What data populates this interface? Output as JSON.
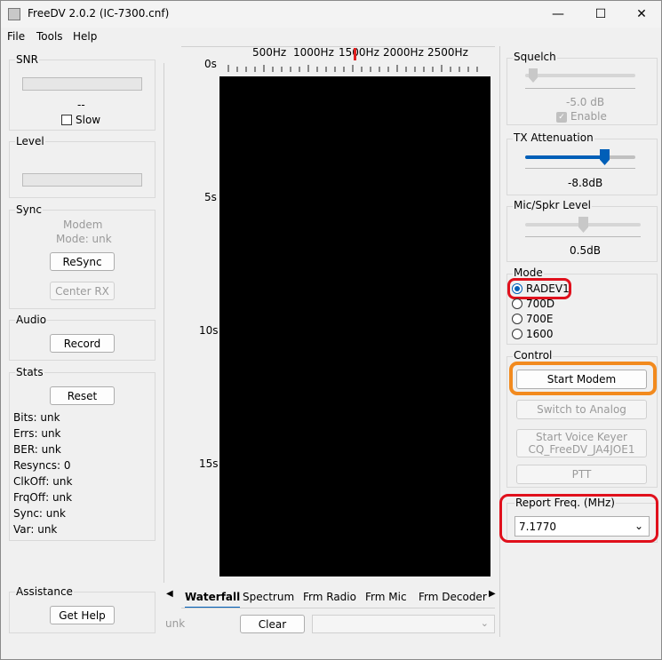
{
  "window": {
    "title": "FreeDV 2.0.2 (IC-7300.cnf)",
    "controls": [
      "—",
      "☐",
      "✕"
    ]
  },
  "menu": [
    "File",
    "Tools",
    "Help"
  ],
  "left": {
    "snr": {
      "label": "SNR",
      "value": "--",
      "slow": "Slow"
    },
    "level": {
      "label": "Level"
    },
    "sync": {
      "label": "Sync",
      "modem": "Modem",
      "mode": "Mode: unk",
      "resync": "ReSync",
      "center_rx": "Center RX"
    },
    "audio": {
      "label": "Audio",
      "record": "Record"
    },
    "stats": {
      "label": "Stats",
      "reset": "Reset",
      "rows": [
        "Bits: unk",
        "Errs: unk",
        "BER: unk",
        "Resyncs: 0",
        "ClkOff: unk",
        "FrqOff: unk",
        "Sync: unk",
        "Var: unk"
      ]
    },
    "assistance": {
      "label": "Assistance",
      "help": "Get Help"
    }
  },
  "waterfall": {
    "freq_labels": [
      "500Hz",
      "1000Hz",
      "1500Hz",
      "2000Hz",
      "2500Hz"
    ],
    "time_labels": [
      "0s",
      "5s",
      "10s",
      "15s"
    ],
    "tabs": [
      "Waterfall",
      "Spectrum",
      "Frm Radio",
      "Frm Mic",
      "Frm Decoder"
    ],
    "active_tab": "Waterfall",
    "status": "unk",
    "clear": "Clear"
  },
  "right": {
    "squelch": {
      "label": "Squelch",
      "value": "-5.0 dB",
      "enable": "Enable"
    },
    "tx_att": {
      "label": "TX Attenuation",
      "value": "-8.8dB"
    },
    "mic_spkr": {
      "label": "Mic/Spkr Level",
      "value": "0.5dB"
    },
    "mode": {
      "label": "Mode",
      "options": [
        "RADEV1",
        "700D",
        "700E",
        "1600"
      ],
      "selected": "RADEV1"
    },
    "control": {
      "label": "Control",
      "start": "Start Modem",
      "switch": "Switch to Analog",
      "voice_keyer_line1": "Start Voice Keyer",
      "voice_keyer_line2": "CQ_FreeDV_JA4JOE1",
      "ptt": "PTT"
    },
    "report": {
      "label": "Report Freq. (MHz)",
      "value": "7.1770"
    }
  },
  "colors": {
    "accent": "#005fb8",
    "highlight_red": "#e0101c",
    "highlight_orange": "#f28a1e",
    "marker": "#e02020"
  }
}
